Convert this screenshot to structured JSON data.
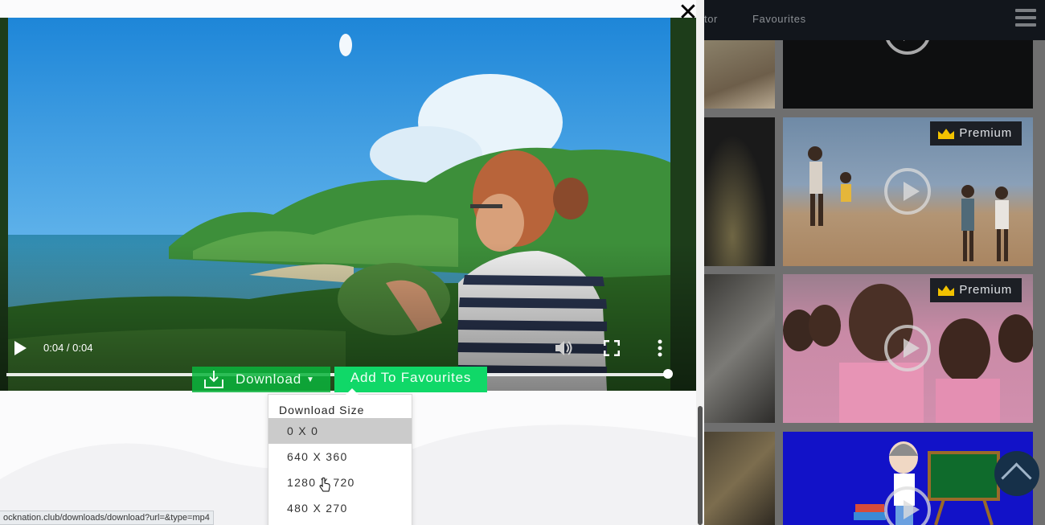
{
  "background": {
    "nav": {
      "partial_link": "tor",
      "favourites": "Favourites"
    },
    "tiles": [
      {
        "premium": "Premium"
      },
      {
        "premium": "Premium"
      }
    ]
  },
  "player": {
    "time": "0:04 / 0:04",
    "progress": 1.0
  },
  "actions": {
    "download_label": "Download",
    "favourites_label": "Add To Favourites"
  },
  "dropdown": {
    "title": "Download Size",
    "options": [
      "0 X 0",
      "640 X 360",
      "1280 X 720",
      "480 X 270"
    ],
    "selected": "0 X 0"
  },
  "status_url": "ocknation.club/downloads/download?url=&type=mp4",
  "colors": {
    "download_button": "#0ab43c",
    "favourites_button": "#10d868",
    "nav_bg": "#12161c",
    "scroll_top": "#163049"
  }
}
